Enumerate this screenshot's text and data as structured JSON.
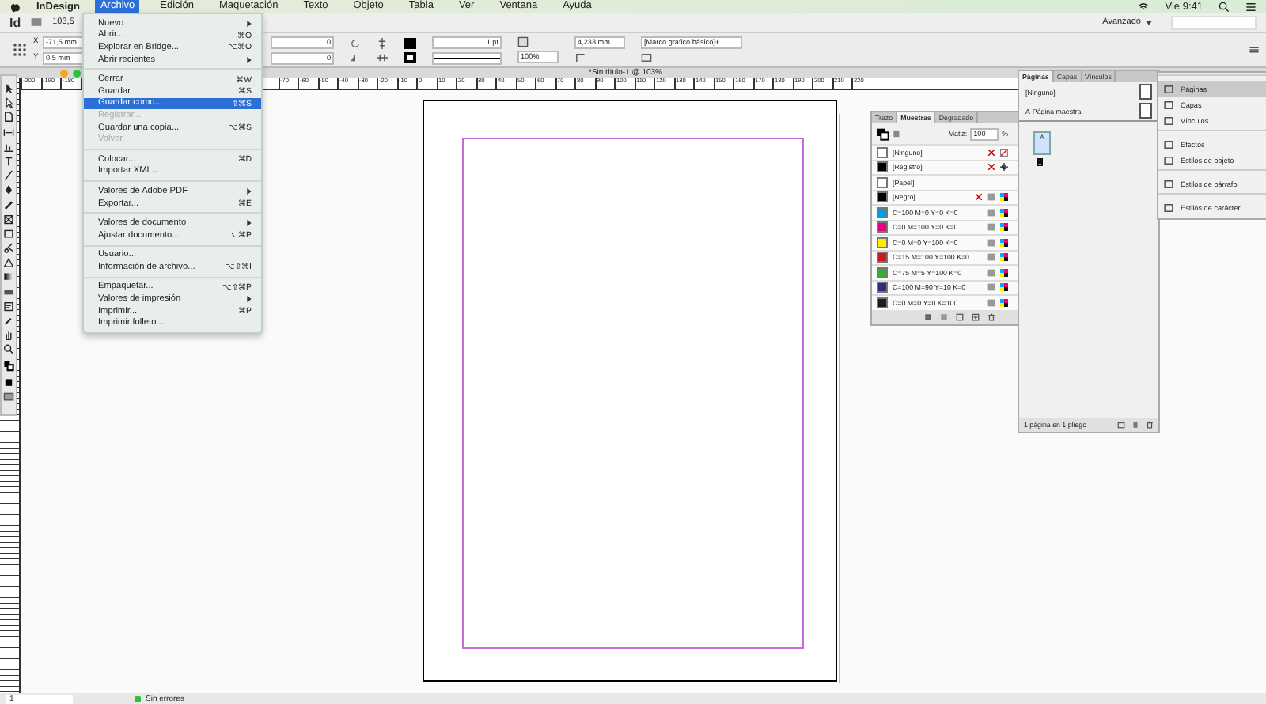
{
  "menu_bar": {
    "app": "InDesign",
    "items": [
      {
        "label": "Archivo",
        "selected": true
      },
      {
        "label": "Edición",
        "selected": false
      },
      {
        "label": "Maquetación",
        "selected": false
      },
      {
        "label": "Texto",
        "selected": false
      },
      {
        "label": "Objeto",
        "selected": false
      },
      {
        "label": "Tabla",
        "selected": false
      },
      {
        "label": "Ver",
        "selected": false
      },
      {
        "label": "Ventana",
        "selected": false
      },
      {
        "label": "Ayuda",
        "selected": false
      }
    ],
    "clock": "Vie 9:41"
  },
  "app_bar": {
    "logo": "Id",
    "zoom": "103,5",
    "workspace": "Avanzado"
  },
  "control_panel": {
    "x_label": "X",
    "x": "-71,5 mm",
    "y_label": "Y",
    "y": "0,5 mm",
    "rotate": "0",
    "shear": "0",
    "stroke_weight": "1 pt",
    "scale": "100%",
    "offset": "4,233 mm",
    "object_style": "[Marco gráfico básico]+"
  },
  "document": {
    "title": "*Sin título-1 @ 103%"
  },
  "ruler": {
    "left_labels": [
      "-200",
      "-190",
      "-180"
    ],
    "labels": [
      "-70",
      "-60",
      "-50",
      "-40",
      "-30",
      "-20",
      "-10",
      "0",
      "10",
      "20",
      "30",
      "40",
      "50",
      "60",
      "70",
      "80",
      "90",
      "100",
      "110",
      "120",
      "130",
      "140",
      "150",
      "160",
      "170",
      "180",
      "190",
      "200",
      "210",
      "220"
    ]
  },
  "file_menu": {
    "groups": [
      [
        {
          "label": "Nuevo",
          "submenu": true,
          "disabled": false,
          "selected": false
        },
        {
          "label": "Abrir...",
          "shortcut": "⌘O",
          "submenu": false,
          "disabled": false,
          "selected": false
        },
        {
          "label": "Explorar en Bridge...",
          "shortcut": "⌥⌘O",
          "submenu": false,
          "disabled": false,
          "selected": false
        },
        {
          "label": "Abrir recientes",
          "submenu": true,
          "disabled": false,
          "selected": false
        }
      ],
      [
        {
          "label": "Cerrar",
          "shortcut": "⌘W",
          "submenu": false,
          "disabled": false,
          "selected": false
        },
        {
          "label": "Guardar",
          "shortcut": "⌘S",
          "submenu": false,
          "disabled": false,
          "selected": false
        },
        {
          "label": "Guardar como...",
          "shortcut": "⇧⌘S",
          "submenu": false,
          "disabled": false,
          "selected": true
        },
        {
          "label": "Registrar...",
          "submenu": false,
          "disabled": true,
          "selected": false
        },
        {
          "label": "Guardar una copia...",
          "shortcut": "⌥⌘S",
          "submenu": false,
          "disabled": false,
          "selected": false
        },
        {
          "label": "Volver",
          "submenu": false,
          "disabled": true,
          "selected": false
        }
      ],
      [
        {
          "label": "Colocar...",
          "shortcut": "⌘D",
          "submenu": false,
          "disabled": false,
          "selected": false
        },
        {
          "label": "Importar XML...",
          "submenu": false,
          "disabled": false,
          "selected": false
        }
      ],
      [
        {
          "label": "Valores de Adobe PDF",
          "submenu": true,
          "disabled": false,
          "selected": false
        },
        {
          "label": "Exportar...",
          "shortcut": "⌘E",
          "submenu": false,
          "disabled": false,
          "selected": false
        }
      ],
      [
        {
          "label": "Valores de documento",
          "submenu": true,
          "disabled": false,
          "selected": false
        },
        {
          "label": "Ajustar documento...",
          "shortcut": "⌥⌘P",
          "submenu": false,
          "disabled": false,
          "selected": false
        }
      ],
      [
        {
          "label": "Usuario...",
          "submenu": false,
          "disabled": false,
          "selected": false
        },
        {
          "label": "Información de archivo...",
          "shortcut": "⌥⇧⌘I",
          "submenu": false,
          "disabled": false,
          "selected": false
        }
      ],
      [
        {
          "label": "Empaquetar...",
          "shortcut": "⌥⇧⌘P",
          "submenu": false,
          "disabled": false,
          "selected": false
        },
        {
          "label": "Valores de impresión",
          "submenu": true,
          "disabled": false,
          "selected": false
        },
        {
          "label": "Imprimir...",
          "shortcut": "⌘P",
          "submenu": false,
          "disabled": false,
          "selected": false
        },
        {
          "label": "Imprimir folleto...",
          "submenu": false,
          "disabled": false,
          "selected": false
        }
      ]
    ]
  },
  "swatches_panel": {
    "tabs": [
      {
        "label": "Trazo",
        "selected": false
      },
      {
        "label": "Muestras",
        "selected": true
      },
      {
        "label": "Degradado",
        "selected": false
      }
    ],
    "tint_label": "Matiz:",
    "tint": "100",
    "tint_unit": "%",
    "swatches": [
      {
        "name": "[Ninguno]",
        "color": "#ffffff",
        "kind": "none"
      },
      {
        "name": "[Registro]",
        "color": "#000000",
        "kind": "registration"
      },
      {
        "name": "[Papel]",
        "color": "#ffffff",
        "kind": "paper"
      },
      {
        "name": "[Negro]",
        "color": "#000000",
        "kind": "black"
      },
      {
        "name": "C=100 M=0 Y=0 K=0",
        "color": "#009fe3",
        "kind": "process"
      },
      {
        "name": "C=0 M=100 Y=0 K=0",
        "color": "#e5007d",
        "kind": "process"
      },
      {
        "name": "C=0 M=0 Y=100 K=0",
        "color": "#ffed00",
        "kind": "process"
      },
      {
        "name": "C=15 M=100 Y=100 K=0",
        "color": "#d2161e",
        "kind": "process"
      },
      {
        "name": "C=75 M=5 Y=100 K=0",
        "color": "#3aa935",
        "kind": "process"
      },
      {
        "name": "C=100 M=90 Y=10 K=0",
        "color": "#2a2e7f",
        "kind": "process"
      },
      {
        "name": "C=0 M=0 Y=0 K=100",
        "color": "#1d1d1b",
        "kind": "process"
      }
    ]
  },
  "pages_panel": {
    "tabs": [
      {
        "label": "Páginas",
        "selected": true
      },
      {
        "label": "Capas",
        "selected": false
      },
      {
        "label": "Vínculos",
        "selected": false
      }
    ],
    "masters": [
      "[Ninguno]",
      "A-Página maestra"
    ],
    "page_prefix": "A",
    "page_number": "1",
    "footer": "1 página en 1 pliego"
  },
  "dock": {
    "groups": [
      [
        {
          "label": "Páginas",
          "selected": true
        },
        {
          "label": "Capas",
          "selected": false
        },
        {
          "label": "Vínculos",
          "selected": false
        }
      ],
      [
        {
          "label": "Efectos",
          "selected": false
        },
        {
          "label": "Estilos de objeto",
          "selected": false
        }
      ],
      [
        {
          "label": "Estilos de párrafo",
          "selected": false
        }
      ],
      [
        {
          "label": "Estilos de carácter",
          "selected": false
        }
      ]
    ]
  },
  "status_bar": {
    "page": "1",
    "preflight": "Sin errores"
  }
}
